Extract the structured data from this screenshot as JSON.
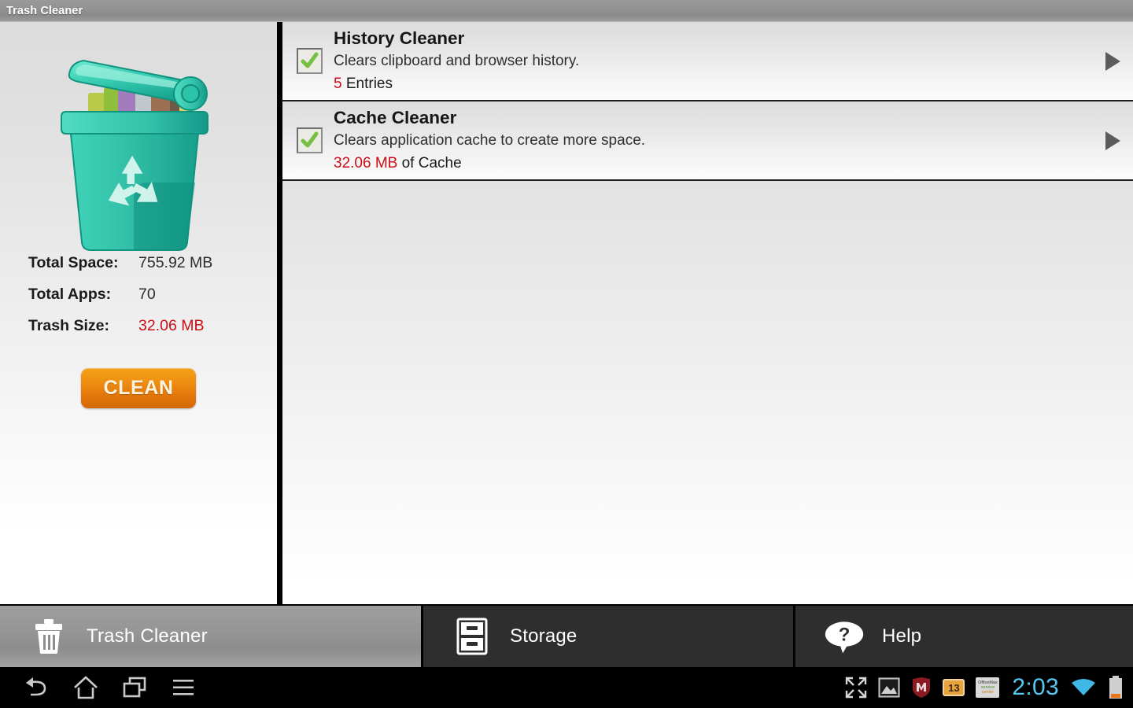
{
  "window": {
    "title": "Trash Cleaner"
  },
  "summary": {
    "illustration_icon": "trash-bin-recycle-illustration",
    "rows": [
      {
        "label": "Total Space:",
        "value": "755.92 MB",
        "danger": false
      },
      {
        "label": "Total Apps:",
        "value": "70",
        "danger": false
      },
      {
        "label": "Trash Size:",
        "value": "32.06 MB",
        "danger": true
      }
    ],
    "clean_button": "CLEAN"
  },
  "cleaner_list": {
    "items": [
      {
        "title": "History Cleaner",
        "description": "Clears clipboard and browser history.",
        "amount": "5",
        "amount_suffix": " Entries",
        "checked": true,
        "checkbox_icon": "checkbox-checked-icon",
        "arrow_icon": "play-arrow-right-icon"
      },
      {
        "title": "Cache Cleaner",
        "description": "Clears application cache to create more space.",
        "amount": "32.06 MB",
        "amount_suffix": " of Cache",
        "checked": true,
        "checkbox_icon": "checkbox-checked-icon",
        "arrow_icon": "play-arrow-right-icon"
      }
    ]
  },
  "tabbar": {
    "tabs": [
      {
        "label": "Trash Cleaner",
        "icon": "trash-can-icon",
        "selected": true
      },
      {
        "label": "Storage",
        "icon": "file-cabinet-icon",
        "selected": false
      },
      {
        "label": "Help",
        "icon": "question-speech-bubble-icon",
        "selected": false
      }
    ]
  },
  "navbar": {
    "buttons": [
      {
        "icon": "back-arrow-icon"
      },
      {
        "icon": "home-icon"
      },
      {
        "icon": "recent-apps-icon"
      },
      {
        "icon": "menu-icon"
      }
    ],
    "status": {
      "icons": [
        "fullscreen-expand-icon",
        "screenshot-image-icon",
        "mcafee-shield-icon"
      ],
      "calendar_day": "13",
      "officemax_line1": "OfficeMax",
      "officemax_line2": "service",
      "officemax_line3": "center",
      "time": "2:03",
      "wifi_icon": "wifi-icon",
      "battery_icon": "battery-low-icon"
    }
  },
  "colors": {
    "danger": "#cc0d15",
    "accent_orange": "#ef8f12",
    "clock_blue": "#54c8f0",
    "check_green": "#76c043",
    "trash_teal": "#2fbfa8"
  }
}
